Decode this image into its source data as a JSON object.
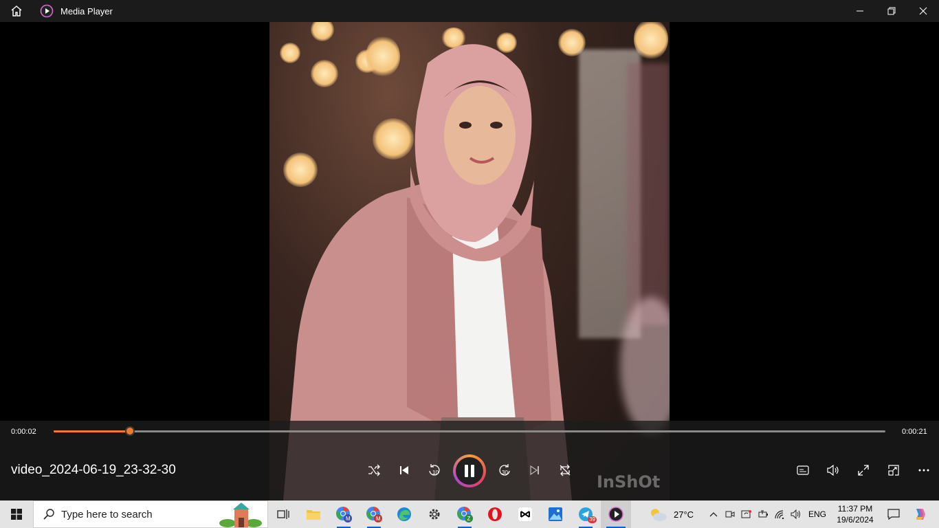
{
  "window": {
    "title": "Media Player"
  },
  "video": {
    "filename": "video_2024-06-19_23-32-30",
    "watermark": "InShOt"
  },
  "playback": {
    "elapsed": "0:00:02",
    "duration": "0:00:21",
    "progress_fraction": 0.092,
    "skip_back_label": "10",
    "skip_forward_label": "30"
  },
  "colors": {
    "accent": "#f07a2a",
    "titlebar": "#1b1b1b",
    "taskbar": "#e4e4e4"
  },
  "taskbar": {
    "search_placeholder": "Type here to search",
    "weather": "27°C",
    "language": "ENG",
    "time": "11:37 PM",
    "date": "19/6/2024",
    "telegram_badge": "39",
    "chrome_profile_1": "M",
    "chrome_profile_2": "M",
    "chrome_profile_3": "Z"
  }
}
